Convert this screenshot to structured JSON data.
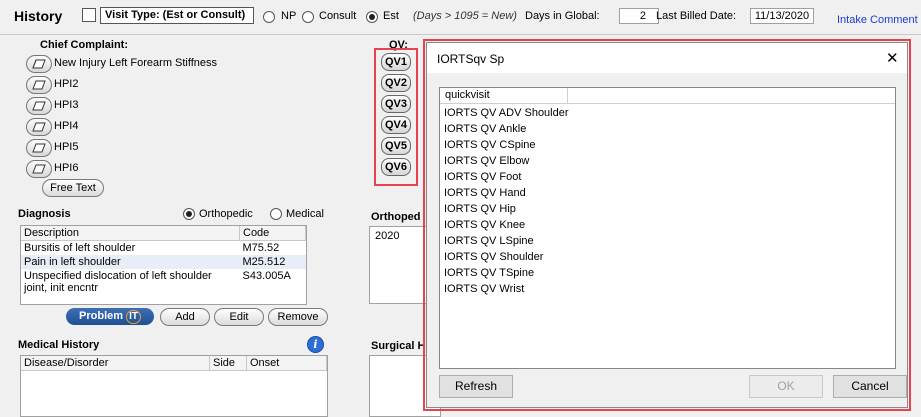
{
  "header": {
    "title": "History",
    "visit_type_label": "Visit Type: (Est or Consult)",
    "radios": [
      {
        "label": "NP",
        "selected": false
      },
      {
        "label": "Consult",
        "selected": false
      },
      {
        "label": "Est",
        "selected": true
      }
    ],
    "days_note": "(Days > 1095 = New)",
    "days_in_global_label": "Days in Global:",
    "days_in_global_value": "2",
    "last_billed_label": "Last Billed Date:",
    "last_billed_value": "11/13/2020",
    "intake_link": "Intake Comment"
  },
  "chief_complaint": {
    "title": "Chief Complaint:",
    "items": [
      "New Injury Left Forearm Stiffness",
      "HPI2",
      "HPI3",
      "HPI4",
      "HPI5",
      "HPI6"
    ],
    "free_text_button": "Free Text"
  },
  "qv": {
    "label": "QV:",
    "buttons": [
      "QV1",
      "QV2",
      "QV3",
      "QV4",
      "QV5",
      "QV6"
    ]
  },
  "diagnosis": {
    "title": "Diagnosis",
    "radios": [
      {
        "label": "Orthopedic",
        "selected": true
      },
      {
        "label": "Medical",
        "selected": false
      }
    ],
    "columns": [
      "Description",
      "Code"
    ],
    "rows": [
      {
        "description": "Bursitis of left shoulder",
        "code": "M75.52"
      },
      {
        "description": "Pain in left shoulder",
        "code": "M25.512"
      },
      {
        "description": "Unspecified dislocation of left shoulder joint, init encntr",
        "code": "S43.005A"
      }
    ],
    "buttons": {
      "problemit_main": "Problem",
      "problemit_it": "IT",
      "add": "Add",
      "edit": "Edit",
      "remove": "Remove"
    }
  },
  "ortho_panel": {
    "title": "Orthoped",
    "value": "2020"
  },
  "medical_history": {
    "title": "Medical History",
    "info_icon_text": "i",
    "columns": [
      "Disease/Disorder",
      "Side",
      "Onset"
    ]
  },
  "surgical_panel": {
    "title": "Surgical H"
  },
  "dialog": {
    "title": "IORTSqv Sp",
    "close_glyph": "✕",
    "list_header": "quickvisit",
    "items": [
      "IORTS QV ADV Shoulder",
      "IORTS QV Ankle",
      "IORTS QV CSpine",
      "IORTS QV Elbow",
      "IORTS QV Foot",
      "IORTS QV Hand",
      "IORTS QV Hip",
      "IORTS QV Knee",
      "IORTS QV LSpine",
      "IORTS QV Shoulder",
      "IORTS QV TSpine",
      "IORTS QV Wrist"
    ],
    "refresh_button": "Refresh",
    "ok_button": "OK",
    "cancel_button": "Cancel"
  },
  "colors": {
    "highlight_red": "#e5434f",
    "link_blue": "#1a3ccf",
    "problemit_blue": "#1f4f92"
  }
}
